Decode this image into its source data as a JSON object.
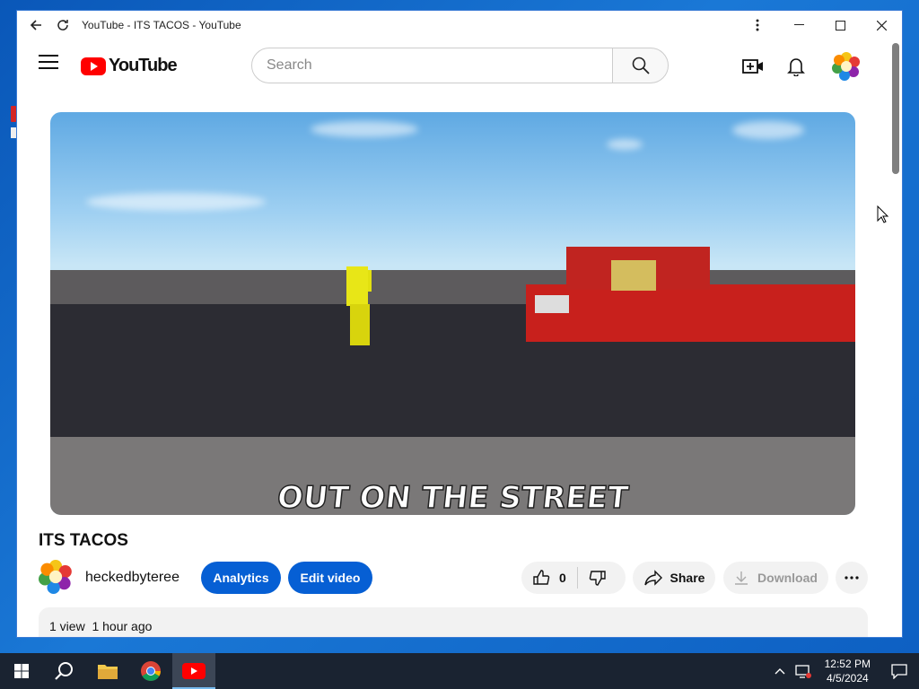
{
  "browser": {
    "title": "YouTube - ITS TACOS - YouTube"
  },
  "youtube": {
    "logo_text": "YouTube",
    "search_placeholder": "Search"
  },
  "video": {
    "caption": "OUT ON THE STREET",
    "title": "ITS TACOS",
    "channel": "heckedbyteree",
    "analytics_label": "Analytics",
    "edit_label": "Edit video",
    "like_count": "0",
    "share_label": "Share",
    "download_label": "Download",
    "views": "1 view",
    "age": "1 hour ago"
  },
  "taskbar": {
    "time": "12:52 PM",
    "date": "4/5/2024"
  },
  "colors": {
    "brand_red": "#ff0000",
    "accent_blue": "#065fd4"
  },
  "icons": [
    "back-icon",
    "reload-icon",
    "more-vert-icon",
    "minimize-icon",
    "maximize-icon",
    "close-icon",
    "menu-icon",
    "search-icon",
    "create-icon",
    "bell-icon",
    "like-icon",
    "dislike-icon",
    "share-icon",
    "download-icon",
    "more-horiz-icon",
    "windows-start-icon",
    "taskbar-search-icon",
    "file-explorer-icon",
    "chrome-icon",
    "youtube-app-icon",
    "chevron-up-icon",
    "network-icon",
    "notification-icon"
  ]
}
